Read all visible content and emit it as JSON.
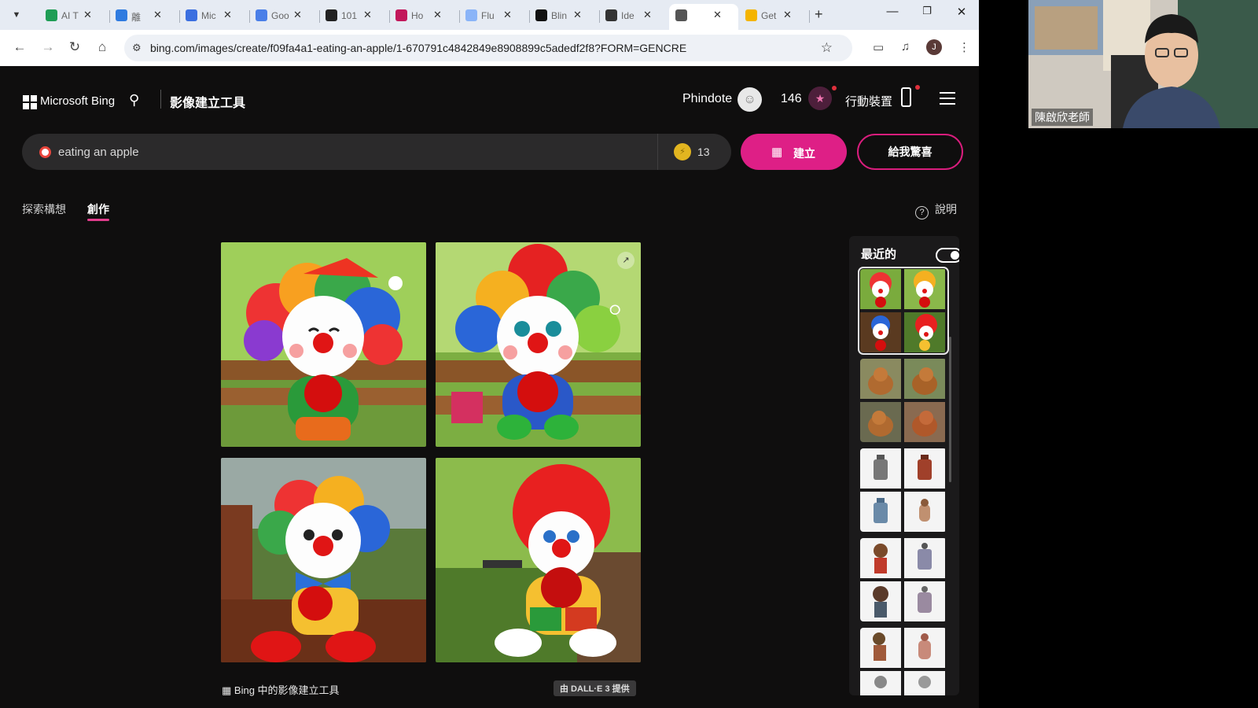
{
  "browser": {
    "tabs": [
      {
        "label": "AI T",
        "favicon": "sheets-icon",
        "color": "#1f9d55"
      },
      {
        "label": "離",
        "favicon": "chrome-c-icon",
        "color": "#2f7be0"
      },
      {
        "label": "Mic",
        "favicon": "docs-icon",
        "color": "#3b6fe0"
      },
      {
        "label": "Goo",
        "favicon": "translate-icon",
        "color": "#4a7fe8"
      },
      {
        "label": "101",
        "favicon": "video-icon",
        "color": "#222222"
      },
      {
        "label": "Ho",
        "favicon": "app-icon",
        "color": "#c2185b"
      },
      {
        "label": "Flu",
        "favicon": "flux-icon",
        "color": "#8ab4f8"
      },
      {
        "label": "Blin",
        "favicon": "triangle-icon",
        "color": "#111111"
      },
      {
        "label": "Ide",
        "favicon": "openai-icon",
        "color": "#333333"
      },
      {
        "label": "",
        "favicon": "bing-search-icon",
        "color": "#555555"
      },
      {
        "label": "Get",
        "favicon": "emoji-icon",
        "color": "#f4b400"
      }
    ],
    "url": "bing.com/images/create/f09fa4a1-eating-an-apple/1-670791c4842849e8908899c5adedf2f8?FORM=GENCRE"
  },
  "header": {
    "brand": "Microsoft Bing",
    "title": "影像建立工具",
    "user": "Phindote",
    "points": "146",
    "mobile": "行動裝置"
  },
  "search": {
    "value": "eating an apple",
    "coins": "13",
    "create_label": "建立",
    "surprise_label": "給我驚喜"
  },
  "tabs": {
    "explore": "探索構想",
    "create": "創作"
  },
  "help_label": "說明",
  "footer": {
    "left": "Bing 中的影像建立工具",
    "right": "由 DALL·E 3 提供"
  },
  "recent": {
    "title": "最近的"
  },
  "webcam": {
    "name": "陳啟欣老師"
  },
  "colors": {
    "accent": "#de1f86",
    "page_bg": "#0f0e0e"
  }
}
